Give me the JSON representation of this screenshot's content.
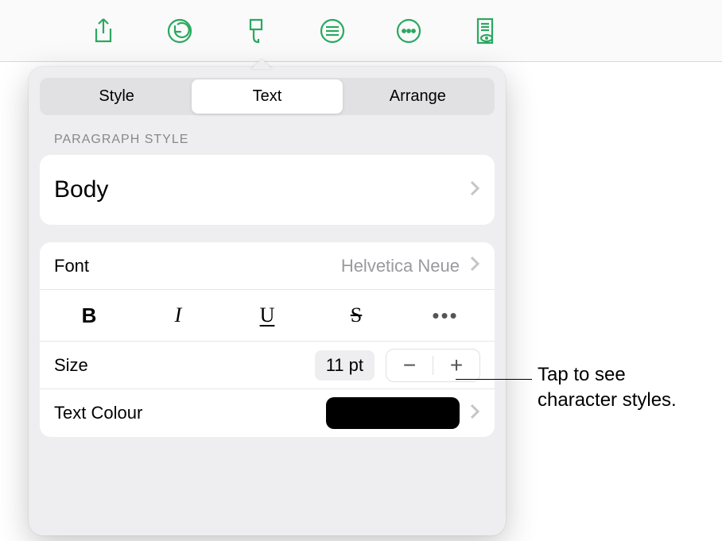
{
  "toolbar": {
    "share": "share",
    "undo": "undo",
    "format": "format-brush",
    "insert": "insert",
    "more": "more",
    "view": "document-view"
  },
  "tabs": {
    "style": "Style",
    "text": "Text",
    "arrange": "Arrange"
  },
  "section": {
    "paragraph_style_label": "PARAGRAPH STYLE"
  },
  "paragraph_style": {
    "current": "Body"
  },
  "font": {
    "label": "Font",
    "value": "Helvetica Neue"
  },
  "format_buttons": {
    "bold": "B",
    "italic": "I",
    "underline": "U",
    "strike": "S",
    "more": "•••"
  },
  "size": {
    "label": "Size",
    "value": "11 pt",
    "dec": "−",
    "inc": "+"
  },
  "text_colour": {
    "label": "Text Colour",
    "swatch_hex": "#000000"
  },
  "callout": {
    "line1": "Tap to see",
    "line2": "character styles."
  }
}
